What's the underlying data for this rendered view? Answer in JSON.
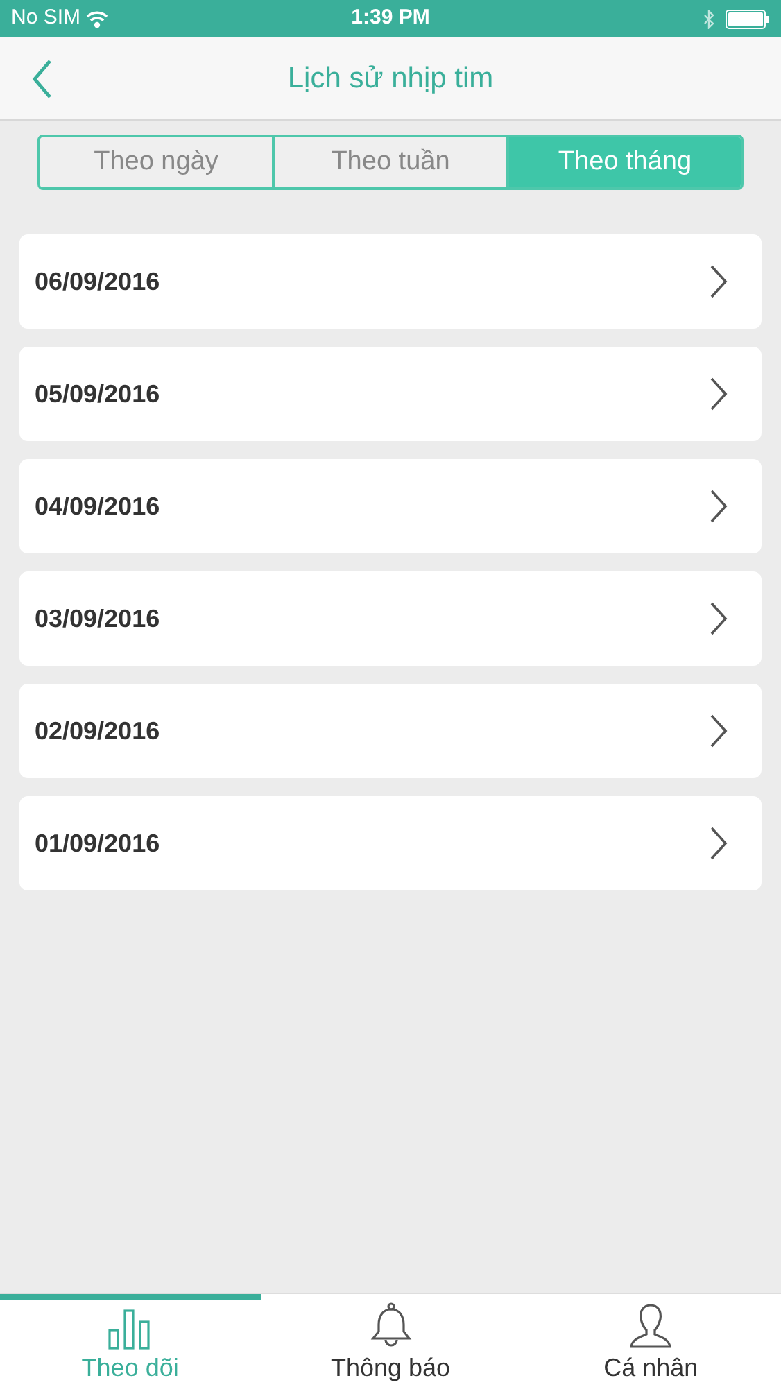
{
  "status_bar": {
    "carrier": "No SIM",
    "time": "1:39 PM"
  },
  "header": {
    "title": "Lịch sử nhịp tim"
  },
  "tabs": [
    {
      "label": "Theo ngày",
      "selected": false
    },
    {
      "label": "Theo tuần",
      "selected": false
    },
    {
      "label": "Theo tháng",
      "selected": true
    }
  ],
  "dates": [
    "06/09/2016",
    "05/09/2016",
    "04/09/2016",
    "03/09/2016",
    "02/09/2016",
    "01/09/2016"
  ],
  "bottom_nav": [
    {
      "label": "Theo dõi",
      "kind": "chart",
      "selected": true
    },
    {
      "label": "Thông báo",
      "kind": "bell",
      "selected": false
    },
    {
      "label": "Cá nhân",
      "kind": "person",
      "selected": false
    }
  ]
}
